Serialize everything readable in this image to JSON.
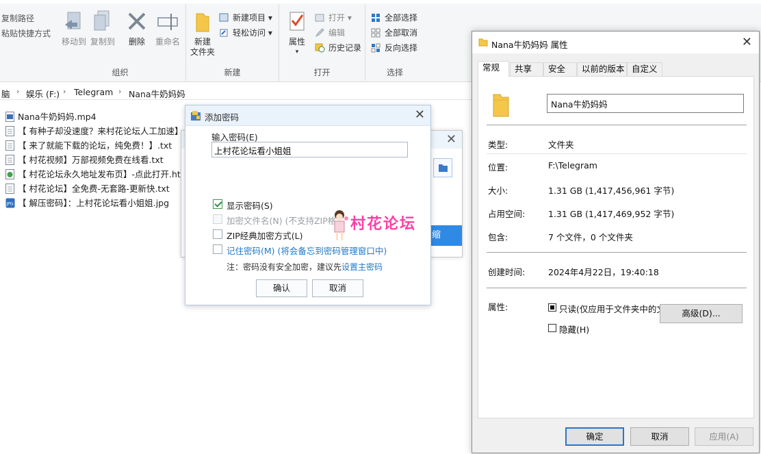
{
  "ribbon": {
    "left_items": [
      "复制路径",
      "粘贴快捷方式"
    ],
    "organize": {
      "label": "组织",
      "move_to": "移动到",
      "copy_to": "复制到",
      "delete": "删除",
      "rename": "重命名"
    },
    "new": {
      "label": "新建",
      "new_folder_line1": "新建",
      "new_folder_line2": "文件夹",
      "new_item": "新建项目",
      "easy_access": "轻松访问"
    },
    "open": {
      "label": "打开",
      "properties": "属性",
      "open": "打开",
      "edit": "编辑",
      "history": "历史记录"
    },
    "select": {
      "label": "选择",
      "select_all": "全部选择",
      "select_none": "全部取消",
      "invert": "反向选择"
    }
  },
  "breadcrumb": [
    "脑",
    "娱乐 (F:)",
    "Telegram",
    "Nana牛奶妈妈"
  ],
  "files": [
    {
      "name": "Nana牛奶妈妈.mp4",
      "icon": "video-file-icon"
    },
    {
      "name": "【 有种子却没速度？来村花论坛人工加速】.t",
      "icon": "text-file-icon"
    },
    {
      "name": "【 来了就能下载的论坛，纯免费！】.txt",
      "icon": "text-file-icon"
    },
    {
      "name": "【 村花视频】万部视频免费在线看.txt",
      "icon": "text-file-icon"
    },
    {
      "name": "【 村花论坛永久地址发布页】-点此打开.htm",
      "icon": "html-file-icon"
    },
    {
      "name": "【 村花论坛】全免费-无套路-更新快.txt",
      "icon": "text-file-icon"
    },
    {
      "name": "【 解压密码】：上村花论坛看小姐姐.jpg",
      "icon": "image-file-icon"
    }
  ],
  "compress_dialog": {
    "button_fragment": "缩"
  },
  "password_dialog": {
    "title": "添加密码",
    "input_label": "输入密码(E)",
    "password_value": "上村花论坛看小姐姐",
    "show_password": "显示密码(S)",
    "encrypt_filenames": "加密文件名(N)",
    "encrypt_filenames_note": "(不支持ZIP格",
    "zip_classic": "ZIP经典加密方式(L)",
    "remember_password": "记住密码(M) (将会备忘到密码管理窗口中)",
    "note_prefix": "注：密码没有安全加密，建议先",
    "note_link": "设置主密码",
    "ok": "确认",
    "cancel": "取消"
  },
  "watermark": {
    "text": "村花论坛"
  },
  "properties": {
    "title": "Nana牛奶妈妈 属性",
    "tabs": [
      "常规",
      "共享",
      "安全",
      "以前的版本",
      "自定义"
    ],
    "name": "Nana牛奶妈妈",
    "type_label": "类型:",
    "type_value": "文件夹",
    "location_label": "位置:",
    "location_value": "F:\\Telegram",
    "size_label": "大小:",
    "size_value": "1.31 GB (1,417,456,961 字节)",
    "disk_label": "占用空间:",
    "disk_value": "1.31 GB (1,417,469,952 字节)",
    "contains_label": "包含:",
    "contains_value": "7 个文件，0 个文件夹",
    "created_label": "创建时间:",
    "created_value": "2024年4月22日，19:40:18",
    "attributes_label": "属性:",
    "readonly": "只读(仅应用于文件夹中的文件)(R)",
    "hidden": "隐藏(H)",
    "advanced": "高级(D)...",
    "ok": "确定",
    "cancel": "取消",
    "apply": "应用(A)"
  },
  "colors": {
    "accent_blue": "#2c74c9",
    "folder_yellow": "#f4c64a",
    "watermark_pink": "#ff3fa6",
    "link_blue": "#1f78c8"
  }
}
